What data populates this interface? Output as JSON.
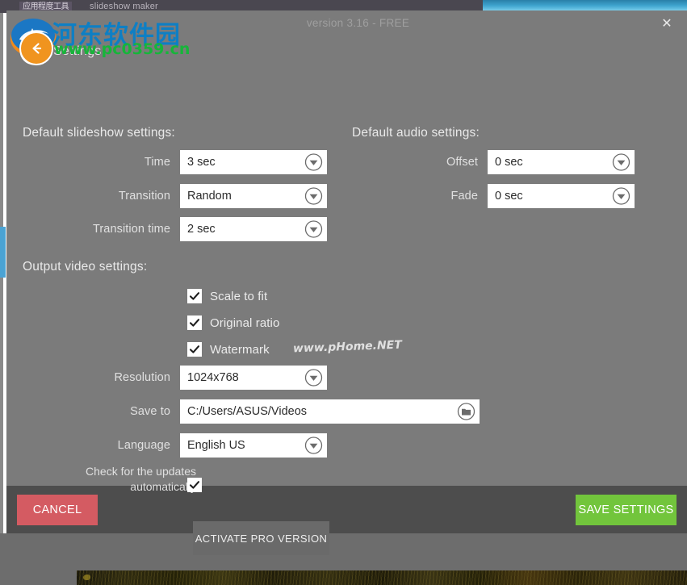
{
  "background_window": {
    "taskbar_item": "应用程度工具",
    "window_title": "slideshow maker",
    "minimize": "–",
    "maximize": "❐",
    "close": "✕"
  },
  "dialog": {
    "version_label": "version 3.16 - FREE",
    "close_label": "✕",
    "title": "Settings",
    "back_icon": "back-arrow-icon"
  },
  "sections": {
    "slideshow": {
      "heading": "Default slideshow settings:",
      "rows": [
        {
          "label": "Time",
          "value": "3 sec",
          "control": "dropdown-arrow-icon"
        },
        {
          "label": "Transition",
          "value": "Random",
          "control": "dropdown-arrow-icon"
        },
        {
          "label": "Transition time",
          "value": "2 sec",
          "control": "dropdown-arrow-icon"
        }
      ]
    },
    "audio": {
      "heading": "Default audio settings:",
      "rows": [
        {
          "label": "Offset",
          "value": "0 sec",
          "control": "dropdown-arrow-icon"
        },
        {
          "label": "Fade",
          "value": "0 sec",
          "control": "dropdown-arrow-icon"
        }
      ]
    },
    "output": {
      "heading": "Output video settings:",
      "checkboxes": [
        {
          "label": "Scale to fit",
          "checked": true
        },
        {
          "label": "Original ratio",
          "checked": true
        },
        {
          "label": "Watermark",
          "checked": true
        }
      ],
      "resolution": {
        "label": "Resolution",
        "value": "1024x768",
        "control": "dropdown-arrow-icon"
      },
      "save_to": {
        "label": "Save to",
        "value": "C:/Users/ASUS/Videos",
        "control": "folder-icon"
      },
      "language": {
        "label": "Language",
        "value": "English US",
        "control": "dropdown-arrow-icon"
      },
      "updates": {
        "label_line1": "Check for the updates",
        "label_line2": "automatically",
        "checked": true
      }
    }
  },
  "buttons": {
    "activate_pro": "ACTIVATE PRO VERSION",
    "cancel": "CANCEL",
    "save_settings": "SAVE SETTINGS"
  },
  "watermarks": {
    "site_cn": "河东软件园",
    "site_url": "www.pc0359.cn",
    "phome": "www.pHome.NET"
  },
  "colors": {
    "dialog_bg": "#7b7b7b",
    "footer_bg": "#4d4d4d",
    "cancel": "#d45b62",
    "save": "#72c53c",
    "accent_blue": "#4aa3d4",
    "pro_button": "#6a6a6a"
  }
}
